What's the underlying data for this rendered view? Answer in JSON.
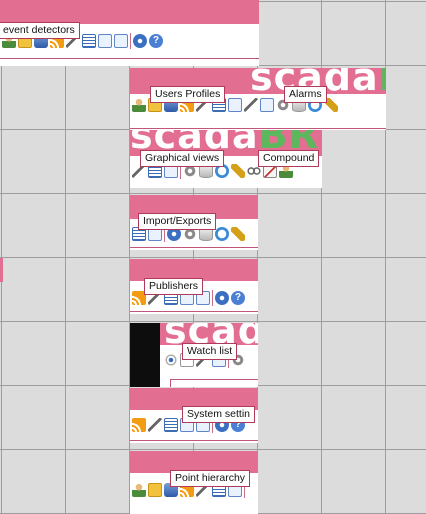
{
  "background_color": "#dcdcdc",
  "accent_color": "#e26f92",
  "brand_logo_text": "scadaBR",
  "tiles": [
    {
      "id": "event-detectors",
      "tooltip": "event detectors"
    },
    {
      "id": "users-profiles",
      "tooltip": "Users Profiles"
    },
    {
      "id": "alarms",
      "tooltip": "Alarms"
    },
    {
      "id": "graphical-views",
      "tooltip": "Graphical views"
    },
    {
      "id": "compound",
      "tooltip": "Compound"
    },
    {
      "id": "import-exports",
      "tooltip": "Import/Exports"
    },
    {
      "id": "publishers",
      "tooltip": "Publishers"
    },
    {
      "id": "watch-list",
      "tooltip": "Watch list"
    },
    {
      "id": "system-settings",
      "tooltip": "System settin"
    },
    {
      "id": "point-hierarchy",
      "tooltip": "Point hierarchy"
    }
  ],
  "toolbar_icons": [
    "user-icon",
    "folder-icon",
    "datasource-icon",
    "publisher-icon",
    "tool-icon",
    "list-icon",
    "reload-icon",
    "page-icon",
    "stop-icon",
    "help-icon",
    "gear-icon",
    "cylinder-icon",
    "clock-icon",
    "broom-icon",
    "eye-icon",
    "link-icon",
    "graph-icon"
  ],
  "help_glyph": "?"
}
